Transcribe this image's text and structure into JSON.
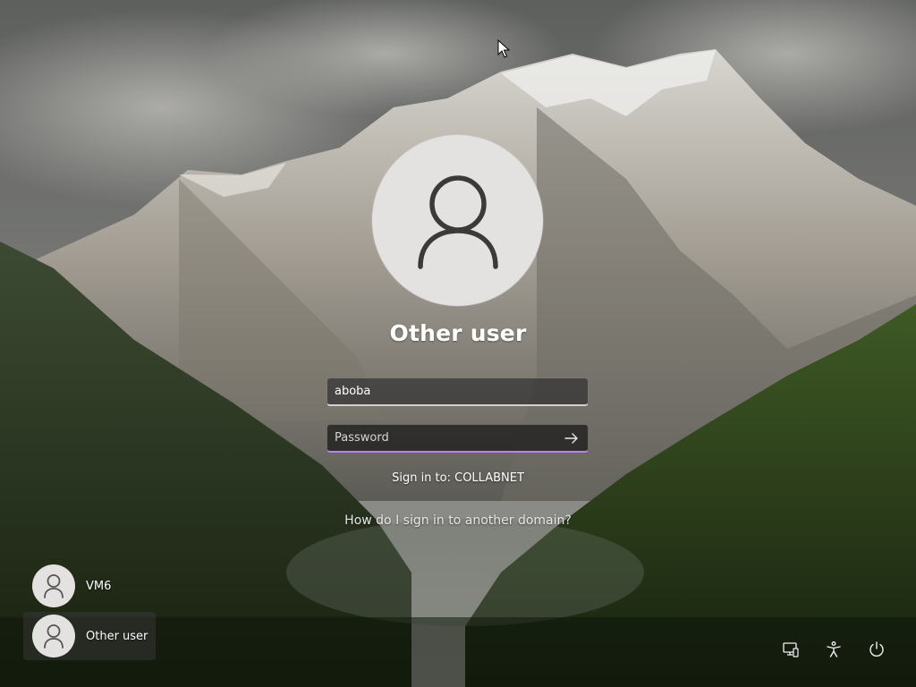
{
  "login": {
    "selected_user_name": "Other user",
    "username_value": "aboba",
    "password_placeholder": "Password",
    "sign_in_to": "Sign in to: COLLABNET",
    "other_domain_link": "How do I sign in to another domain?"
  },
  "users": [
    {
      "name": "VM6",
      "selected": false
    },
    {
      "name": "Other user",
      "selected": true
    }
  ],
  "corner_icons": [
    "network-icon",
    "accessibility-icon",
    "power-icon"
  ],
  "colors": {
    "password_focus_underline": "#c27cf0",
    "avatar_background": "#e3e2e0",
    "avatar_glyph": "#3a3a3a"
  }
}
